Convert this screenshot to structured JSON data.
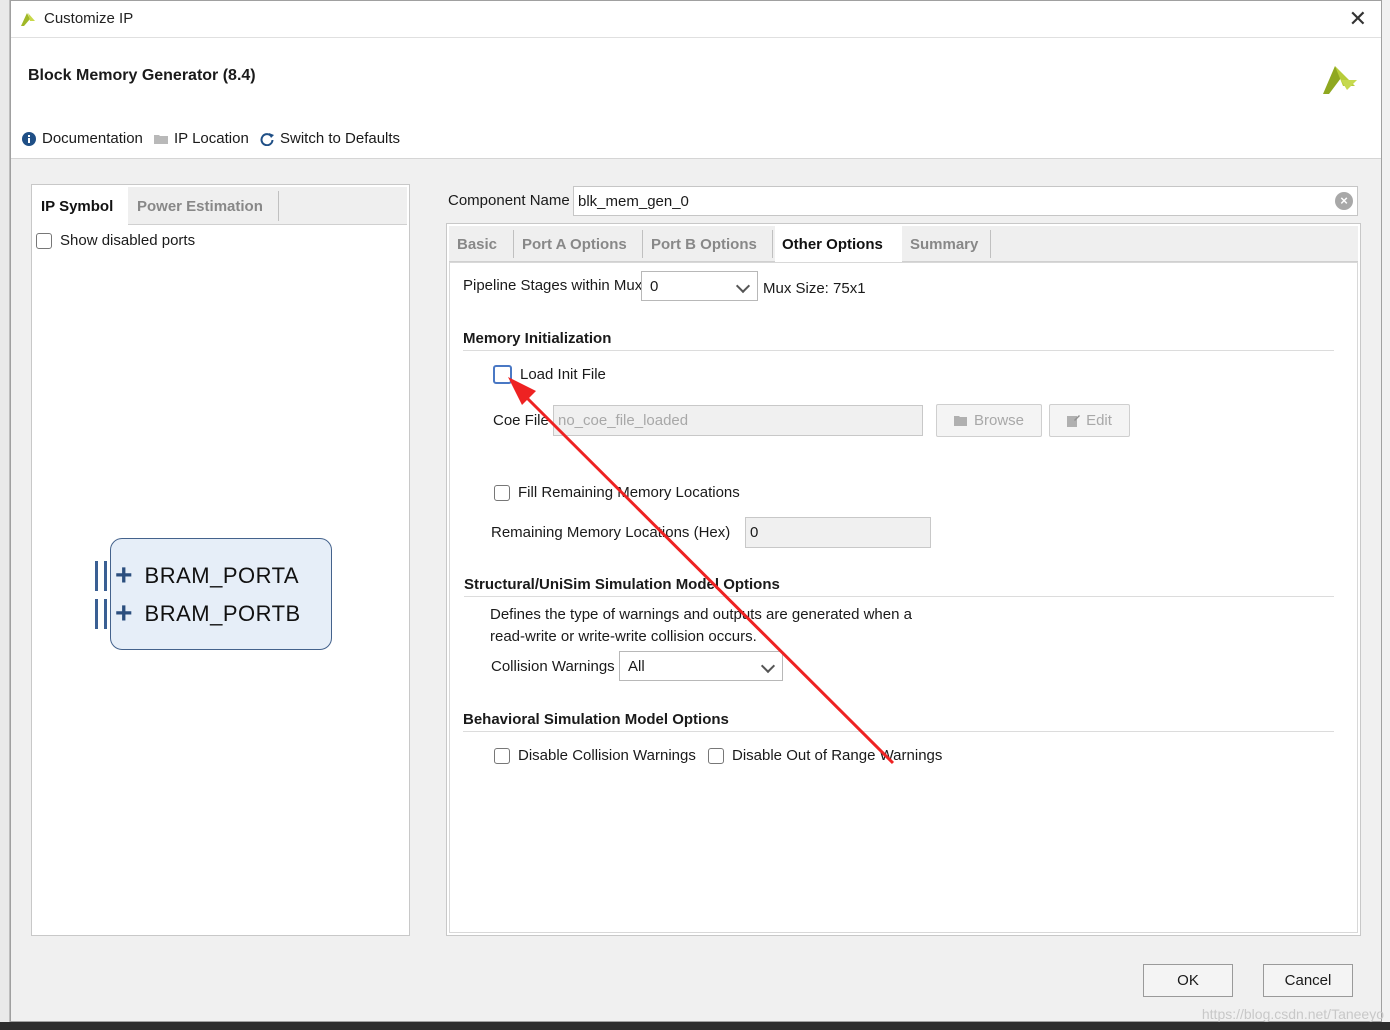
{
  "window": {
    "title": "Customize IP",
    "ip_title": "Block Memory Generator (8.4)"
  },
  "toolbar": {
    "documentation": "Documentation",
    "ip_location": "IP Location",
    "switch_defaults": "Switch to Defaults"
  },
  "left": {
    "tabs": [
      "IP Symbol",
      "Power Estimation"
    ],
    "show_disabled_ports": "Show disabled ports",
    "ports": [
      "BRAM_PORTA",
      "BRAM_PORTB"
    ]
  },
  "component": {
    "label": "Component Name",
    "value": "blk_mem_gen_0"
  },
  "right": {
    "tabs": [
      "Basic",
      "Port A Options",
      "Port B Options",
      "Other Options",
      "Summary"
    ],
    "active_tab": "Other Options",
    "pipeline": {
      "label": "Pipeline Stages within Mux",
      "value": "0",
      "mux_size": "Mux Size: 75x1"
    },
    "memory_init": {
      "title": "Memory Initialization",
      "load_init_file": "Load Init File",
      "coe_label": "Coe File",
      "coe_value": "no_coe_file_loaded",
      "browse": "Browse",
      "edit": "Edit",
      "fill_remaining": "Fill Remaining Memory Locations",
      "remaining_label": "Remaining Memory Locations (Hex)",
      "remaining_value": "0"
    },
    "structural": {
      "title": "Structural/UniSim Simulation Model Options",
      "desc_line1": "Defines the type of warnings and outputs are generated when a",
      "desc_line2": "read-write or write-write collision occurs.",
      "collision_label": "Collision Warnings",
      "collision_value": "All"
    },
    "behavioral": {
      "title": "Behavioral Simulation Model Options",
      "disable_collision": "Disable Collision Warnings",
      "disable_range": "Disable Out of Range Warnings"
    }
  },
  "buttons": {
    "ok": "OK",
    "cancel": "Cancel"
  },
  "watermark": "https://blog.csdn.net/Taneeyo",
  "colors": {
    "accent": "#4a78c4",
    "arrow": "#ee2222",
    "xilinx": "#a0b828"
  }
}
